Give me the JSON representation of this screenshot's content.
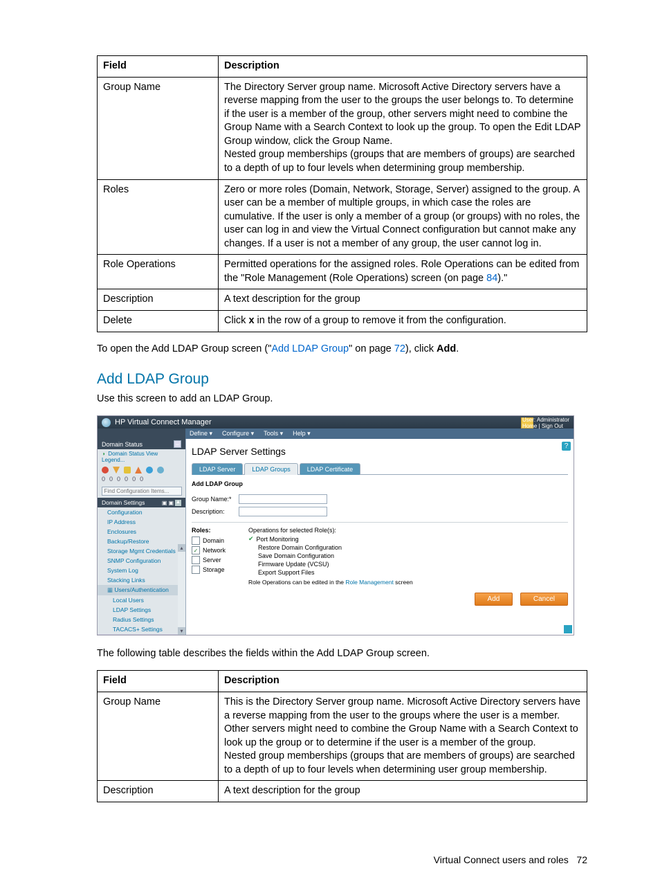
{
  "table1": {
    "headers": {
      "field": "Field",
      "desc": "Description"
    },
    "rows": [
      {
        "field": "Group Name",
        "desc": "The Directory Server group name. Microsoft Active Directory servers have a reverse mapping from the user to the groups the user belongs to. To determine if the user is a member of the group, other servers might need to combine the Group Name with a Search Context to look up the group. To open the Edit LDAP Group window, click the Group Name.\nNested group memberships (groups that are members of groups) are searched to a depth of up to four levels when determining group membership."
      },
      {
        "field": "Roles",
        "desc": "Zero or more roles (Domain, Network, Storage, Server) assigned to the group. A user can be a member of multiple groups, in which case the roles are cumulative. If the user is only a member of a group (or groups) with no roles, the user can log in and view the Virtual Connect configuration but cannot make any changes. If a user is not a member of any group, the user cannot log in."
      },
      {
        "field": "Role Operations",
        "desc_pre": "Permitted operations for the assigned roles. Role Operations can be edited from the \"Role Management (Role Operations) screen (on page ",
        "link": "84",
        "desc_post": ").\""
      },
      {
        "field": "Description",
        "desc": "A text description for the group"
      },
      {
        "field": "Delete",
        "desc_pre": "Click ",
        "bold": "x",
        "desc_post": " in the row of a group to remove it from the configuration."
      }
    ]
  },
  "para1": {
    "pre": "To open the Add LDAP Group screen (\"",
    "link1": "Add LDAP Group",
    "mid": "\" on page ",
    "link2": "72",
    "post": "), click ",
    "bold": "Add",
    "end": "."
  },
  "heading": "Add LDAP Group",
  "para2": "Use this screen to add an LDAP Group.",
  "screenshot": {
    "app_title": "HP Virtual Connect Manager",
    "user_lines": {
      "l1": "User: Administrator",
      "l2a": "Home",
      "l2b": "Sign Out"
    },
    "menu": [
      "Define ▾",
      "Configure ▾",
      "Tools ▾",
      "Help ▾"
    ],
    "domain_status": "Domain Status",
    "ds_link": "Domain Status   View Legend...",
    "mini_zeros": [
      "0",
      "0",
      "0",
      "0",
      "0",
      "0"
    ],
    "find_placeholder": "Find Configuration Items...",
    "section_head": "Domain Settings",
    "nav": [
      "Configuration",
      "IP Address",
      "Enclosures",
      "Backup/Restore",
      "Storage Mgmt Credentials",
      "SNMP Configuration",
      "System Log",
      "Stacking Links"
    ],
    "nav_sel": "Users/Authentication",
    "nav_sub": [
      "Local Users",
      "LDAP Settings",
      "Radius Settings",
      "TACACS+ Settings"
    ],
    "main_title": "LDAP Server Settings",
    "tabs": [
      "LDAP Server",
      "LDAP Groups",
      "LDAP Certificate"
    ],
    "sub_head": "Add LDAP Group",
    "form": {
      "group_name": "Group Name:*",
      "description": "Description:"
    },
    "roles_head": "Roles:",
    "ops_head": "Operations for selected Role(s):",
    "roles": [
      {
        "label": "Domain",
        "checked": false
      },
      {
        "label": "Network",
        "checked": true
      },
      {
        "label": "Server",
        "checked": false
      },
      {
        "label": "Storage",
        "checked": false
      }
    ],
    "ops": [
      "Port Monitoring",
      "Restore Domain Configuration",
      "Save Domain Configuration",
      "Firmware Update (VCSU)",
      "Export Support Files"
    ],
    "rm_text_pre": "Role Operations can be edited in the ",
    "rm_link": "Role Management",
    "rm_text_post": " screen",
    "btn_add": "Add",
    "btn_cancel": "Cancel"
  },
  "para3": "The following table describes the fields within the Add LDAP Group screen.",
  "table2": {
    "headers": {
      "field": "Field",
      "desc": "Description"
    },
    "rows": [
      {
        "field": "Group Name",
        "desc": "This is the Directory Server group name. Microsoft Active Directory servers have a reverse mapping from the user to the groups where the user is a member. Other servers might need to combine the Group Name with a Search Context to look up the group or to determine if the user is a member of the group.\nNested group memberships (groups that are members of groups) are searched to a depth of up to four levels when determining user group membership."
      },
      {
        "field": "Description",
        "desc": "A text description for the group"
      }
    ]
  },
  "footer": {
    "text": "Virtual Connect users and roles",
    "page": "72"
  }
}
